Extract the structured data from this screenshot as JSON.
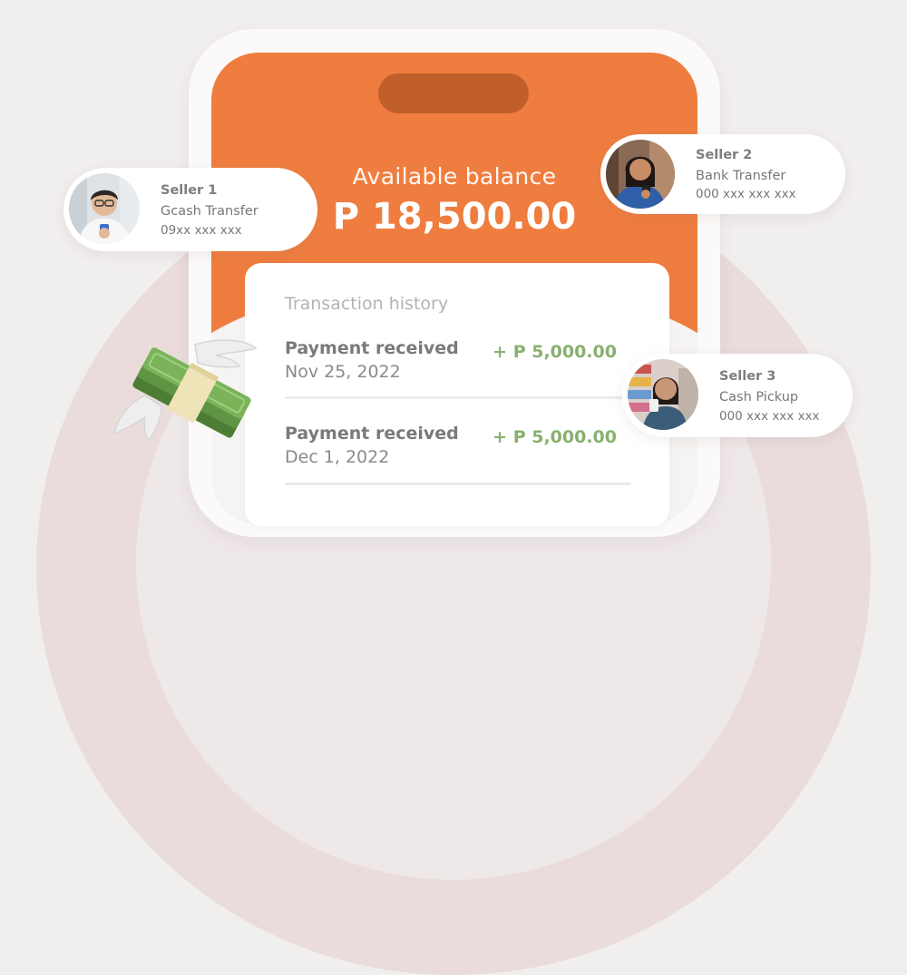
{
  "balance": {
    "label": "Available balance",
    "amount": "P 18,500.00"
  },
  "history": {
    "title": "Transaction history",
    "items": [
      {
        "title": "Payment received",
        "date": "Nov 25, 2022",
        "amount": "+ P 5,000.00"
      },
      {
        "title": "Payment received",
        "date": "Dec 1, 2022",
        "amount": "+ P 5,000.00"
      }
    ]
  },
  "sellers": [
    {
      "name": "Seller 1",
      "method": "Gcash Transfer",
      "account": "09xx xxx xxx"
    },
    {
      "name": "Seller 2",
      "method": "Bank Transfer",
      "account": "000 xxx xxx xxx"
    },
    {
      "name": "Seller 3",
      "method": "Cash Pickup",
      "account": "000 xxx xxx xxx"
    }
  ],
  "colors": {
    "accent": "#ef7d3f",
    "positive_amount": "#88b06f",
    "background": "#f1eeee"
  }
}
